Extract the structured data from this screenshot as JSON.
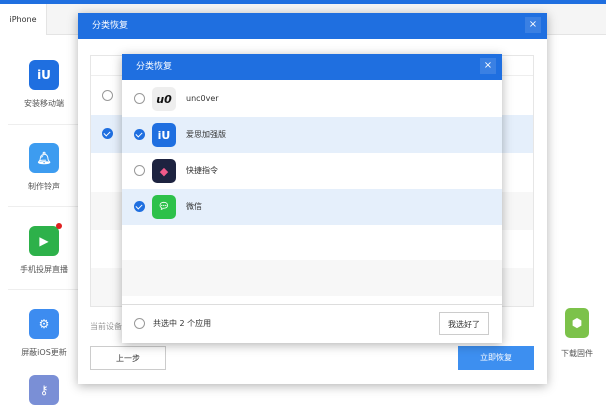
{
  "tab": "iPhone",
  "sidebar": [
    {
      "label": "安装移动端",
      "icon": "iu-app-icon",
      "color": "#1f6fe0"
    },
    {
      "label": "制作铃声",
      "icon": "bell-icon",
      "color": "#3d9cf0"
    },
    {
      "label": "手机投屏直播",
      "icon": "screen-mirror-icon",
      "color": "#2db14a"
    },
    {
      "label": "屏蔽iOS更新",
      "icon": "gear-icon",
      "color": "#3d8cf0"
    },
    {
      "label": "",
      "icon": "key-icon",
      "color": "#7a8fd6"
    }
  ],
  "right_item": {
    "label": "下载固件",
    "icon": "box-icon",
    "color": "#7cc24a"
  },
  "outer": {
    "title": "分类恢复",
    "close": "×",
    "device_text": "当前设备",
    "prev": "上一步",
    "restore": "立即恢复"
  },
  "inner": {
    "title": "分类恢复",
    "close": "×",
    "apps": [
      {
        "name": "unc0ver",
        "checked": false,
        "icon": "u0"
      },
      {
        "name": "爱思加强版",
        "checked": true,
        "icon": "iU"
      },
      {
        "name": "快捷指令",
        "checked": false,
        "icon": "◆"
      },
      {
        "name": "微信",
        "checked": true,
        "icon": "wx"
      }
    ],
    "summary": "共选中 2 个应用",
    "done": "我选好了"
  }
}
